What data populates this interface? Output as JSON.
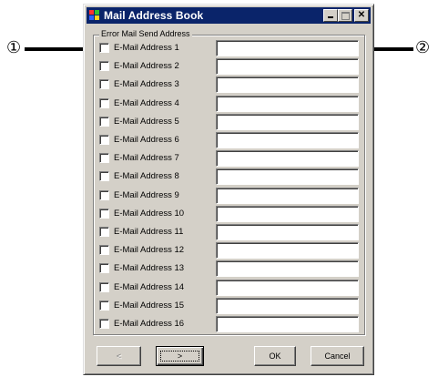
{
  "window": {
    "title": "Mail Address Book",
    "controls": [
      "minimize",
      "maximize",
      "close"
    ]
  },
  "group": {
    "legend": "Error Mail Send Address"
  },
  "rows": [
    {
      "label": "E-Mail Address  1",
      "checked": false,
      "value": ""
    },
    {
      "label": "E-Mail Address  2",
      "checked": false,
      "value": ""
    },
    {
      "label": "E-Mail Address  3",
      "checked": false,
      "value": ""
    },
    {
      "label": "E-Mail Address  4",
      "checked": false,
      "value": ""
    },
    {
      "label": "E-Mail Address  5",
      "checked": false,
      "value": ""
    },
    {
      "label": "E-Mail Address  6",
      "checked": false,
      "value": ""
    },
    {
      "label": "E-Mail Address  7",
      "checked": false,
      "value": ""
    },
    {
      "label": "E-Mail Address  8",
      "checked": false,
      "value": ""
    },
    {
      "label": "E-Mail Address  9",
      "checked": false,
      "value": ""
    },
    {
      "label": "E-Mail Address 10",
      "checked": false,
      "value": ""
    },
    {
      "label": "E-Mail Address 11",
      "checked": false,
      "value": ""
    },
    {
      "label": "E-Mail Address 12",
      "checked": false,
      "value": ""
    },
    {
      "label": "E-Mail Address 13",
      "checked": false,
      "value": ""
    },
    {
      "label": "E-Mail Address 14",
      "checked": false,
      "value": ""
    },
    {
      "label": "E-Mail Address 15",
      "checked": false,
      "value": ""
    },
    {
      "label": "E-Mail Address 16",
      "checked": false,
      "value": ""
    }
  ],
  "buttons": {
    "prev_label": "<",
    "next_label": ">",
    "ok_label": "OK",
    "cancel_label": "Cancel"
  },
  "callouts": {
    "left": "①",
    "right": "②"
  },
  "colors": {
    "titlebar": "#0a246a",
    "dialog_face": "#d4d0c8"
  }
}
